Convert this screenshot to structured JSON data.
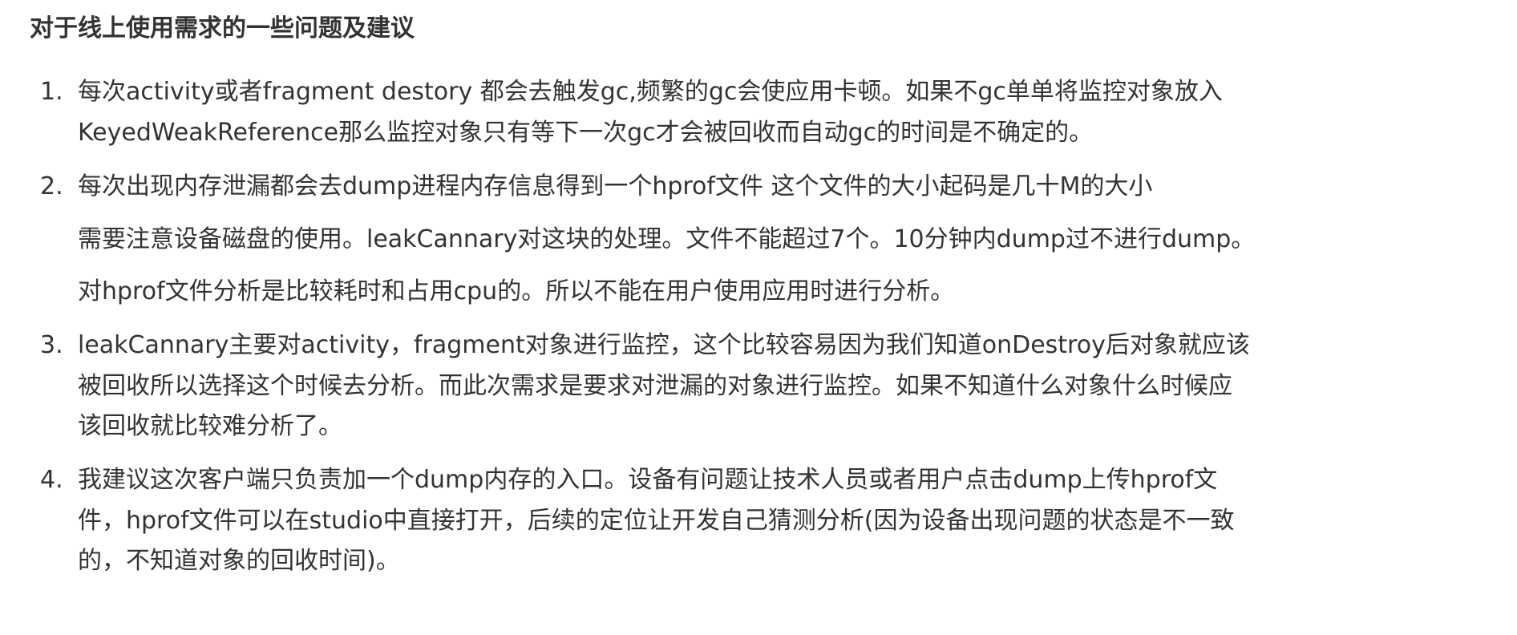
{
  "title": "对于线上使用需求的一些问题及建议",
  "items": [
    {
      "number": "1.",
      "lines": [
        "每次activity或者fragment destory 都会去触发gc,频繁的gc会使应用卡顿。如果不gc单单将监控对象放入",
        "KeyedWeakReference那么监控对象只有等下一次gc才会被回收而自动gc的时间是不确定的。"
      ]
    },
    {
      "number": "2.",
      "lines": [
        "每次出现内存泄漏都会去dump进程内存信息得到一个hprof文件 这个文件的大小起码是几十M的大小",
        "需要注意设备磁盘的使用。leakCannary对这块的处理。文件不能超过7个。10分钟内dump过不进行dump。",
        "对hprof文件分析是比较耗时和占用cpu的。所以不能在用户使用应用时进行分析。"
      ]
    },
    {
      "number": "3.",
      "lines": [
        "leakCannary主要对activity，fragment对象进行监控，这个比较容易因为我们知道onDestroy后对象就应该",
        "被回收所以选择这个时候去分析。而此次需求是要求对泄漏的对象进行监控。如果不知道什么对象什么时候应",
        "该回收就比较难分析了。"
      ]
    },
    {
      "number": "4.",
      "lines": [
        "我建议这次客户端只负责加一个dump内存的入口。设备有问题让技术人员或者用户点击dump上传hprof文",
        "件，hprof文件可以在studio中直接打开，后续的定位让开发自己猜测分析(因为设备出现问题的状态是不一致",
        "的，不知道对象的回收时间)。"
      ]
    }
  ]
}
